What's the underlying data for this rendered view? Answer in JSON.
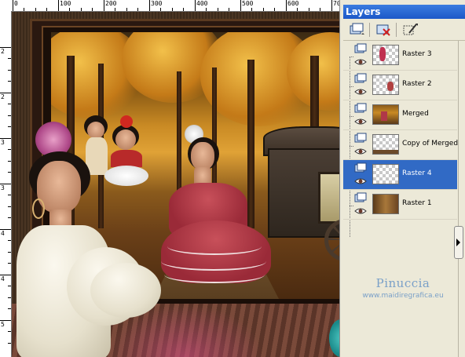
{
  "ruler_top": {
    "labels": [
      "0",
      "100",
      "200",
      "300",
      "400",
      "500",
      "600",
      "70"
    ]
  },
  "ruler_left": {
    "labels": [
      "2",
      "2",
      "3",
      "3",
      "4",
      "4",
      "5",
      "5"
    ]
  },
  "layers_palette": {
    "title": "Layers",
    "toolbar_icons": [
      "new-layer-icon",
      "delete-layer-icon",
      "layer-properties-icon"
    ],
    "layers": [
      {
        "name": "Raster 3",
        "selected": false
      },
      {
        "name": "Raster 2",
        "selected": false
      },
      {
        "name": "Merged",
        "selected": false
      },
      {
        "name": "Copy of Merged",
        "selected": false
      },
      {
        "name": "Raster 4",
        "selected": true
      },
      {
        "name": "Raster 1",
        "selected": false
      }
    ],
    "selected_color": "#316ac5"
  },
  "watermark": {
    "line1": "Pinuccia",
    "line2": "www.maidiregrafica.eu"
  },
  "colors": {
    "title_bar": "#1c58c8",
    "panel_bg": "#ece9d8"
  }
}
